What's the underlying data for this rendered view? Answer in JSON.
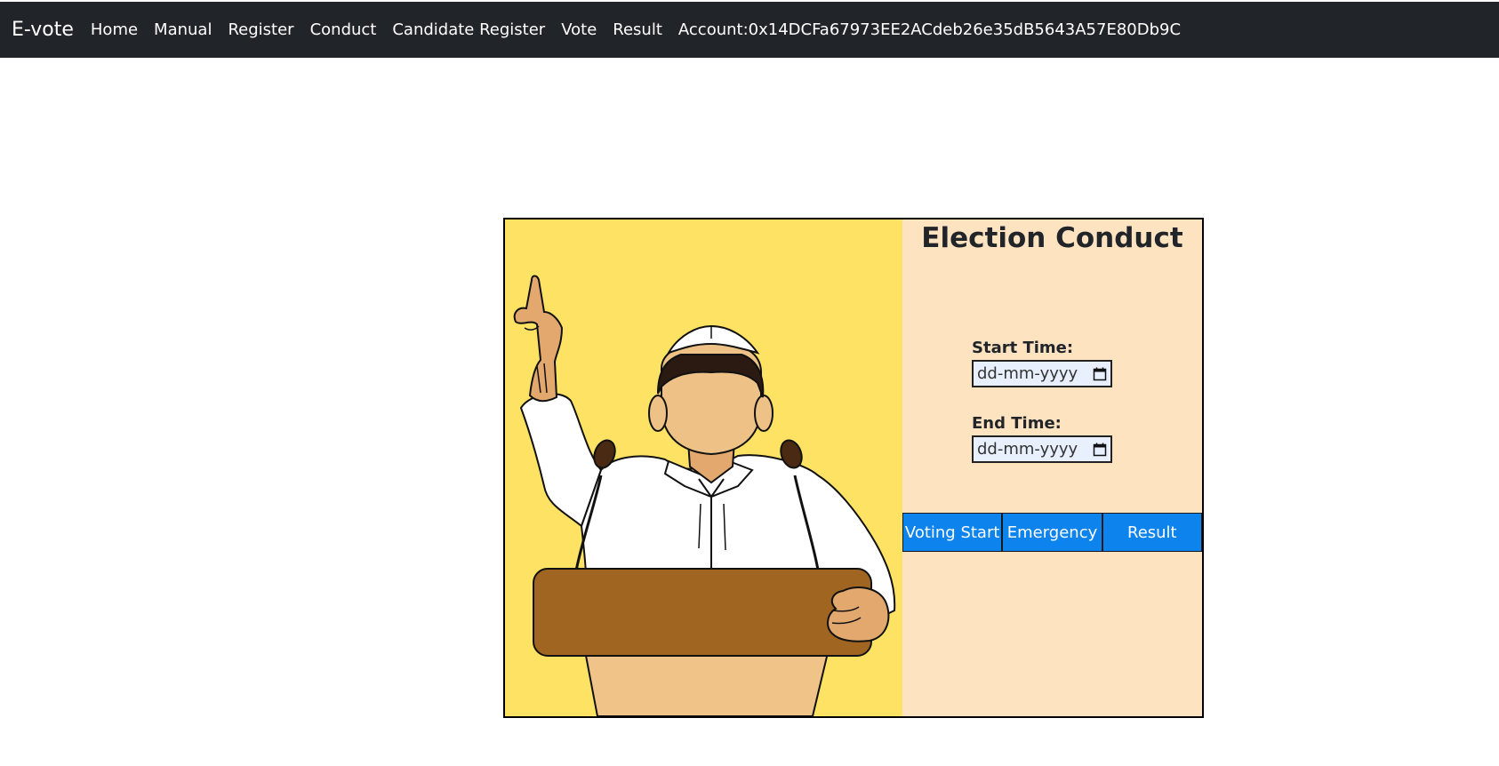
{
  "navbar": {
    "brand": "E-vote",
    "links": [
      "Home",
      "Manual",
      "Register",
      "Conduct",
      "Candidate Register",
      "Vote",
      "Result"
    ],
    "account": "Account:0x14DCFa67973EE2ACdeb26e35dB5643A57E80Db9C"
  },
  "conduct": {
    "title": "Election Conduct",
    "start_label": "Start Time:",
    "start_placeholder": "dd-mm-yyyy",
    "end_label": "End Time:",
    "end_placeholder": "dd-mm-yyyy",
    "buttons": {
      "voting_start": "Voting Start",
      "emergency": "Emergency",
      "result": "Result"
    }
  },
  "colors": {
    "navbar": "#212529",
    "illustration_bg": "#fde264",
    "panel_bg": "#fde3c0",
    "button": "#0d83ee"
  },
  "icons": {
    "date": "calendar-icon"
  }
}
